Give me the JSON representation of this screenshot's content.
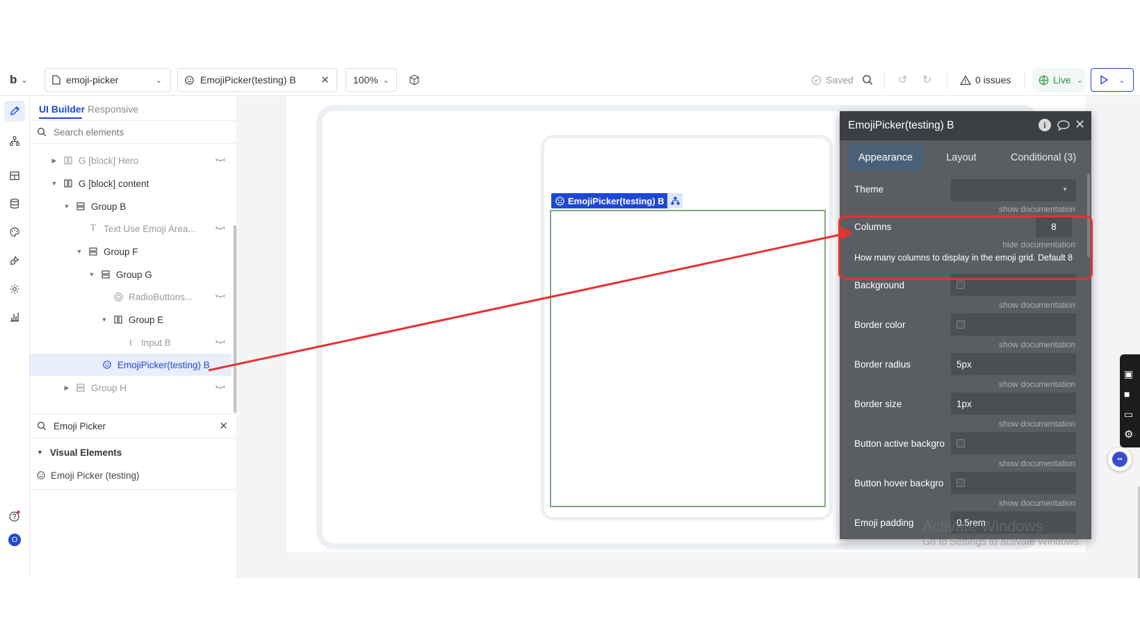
{
  "topbar": {
    "logo": "b",
    "page_name": "emoji-picker",
    "element_name": "EmojiPicker(testing) B",
    "zoom": "100%",
    "saved": "Saved",
    "issues": "0 issues",
    "live": "Live"
  },
  "panel": {
    "tab_builder": "UI Builder",
    "tab_responsive": "Responsive",
    "search_placeholder": "Search elements",
    "tree": [
      {
        "label": "G [block] Hero"
      },
      {
        "label": "G [block] content"
      },
      {
        "label": "Group B"
      },
      {
        "label": "Text Use Emoji Area..."
      },
      {
        "label": "Group F"
      },
      {
        "label": "Group G"
      },
      {
        "label": "RadioButtons..."
      },
      {
        "label": "Group E"
      },
      {
        "label": "Input B"
      },
      {
        "label": "EmojiPicker(testing) B"
      },
      {
        "label": "Group H"
      }
    ],
    "add_search_value": "Emoji Picker",
    "category": "Visual Elements",
    "result": "Emoji Picker (testing)"
  },
  "canvas": {
    "element_tag": "EmojiPicker(testing) B"
  },
  "editor": {
    "title": "EmojiPicker(testing) B",
    "tabs": [
      "Appearance",
      "Layout",
      "Conditional (3)"
    ],
    "show_doc": "show documentation",
    "hide_doc": "hide documentation",
    "props": {
      "theme": {
        "label": "Theme",
        "value": ""
      },
      "columns": {
        "label": "Columns",
        "value": "8",
        "doc": "How many columns to display in the emoji grid. Default 8"
      },
      "background": {
        "label": "Background"
      },
      "border_color": {
        "label": "Border color"
      },
      "border_radius": {
        "label": "Border radius",
        "value": "5px"
      },
      "border_size": {
        "label": "Border size",
        "value": "1px"
      },
      "btn_active": {
        "label": "Button active backgro"
      },
      "btn_hover": {
        "label": "Button hover backgro"
      },
      "emoji_padding": {
        "label": "Emoji padding",
        "value": "0.5rem"
      }
    }
  },
  "watermark": {
    "line1": "Activate Windows",
    "line2": "Go to Settings to activate Windows."
  },
  "colors": {
    "accent": "#1f47d6",
    "annotation": "#e8312e",
    "editor_bg": "#5a5e63",
    "editor_head": "#3b3f43"
  }
}
